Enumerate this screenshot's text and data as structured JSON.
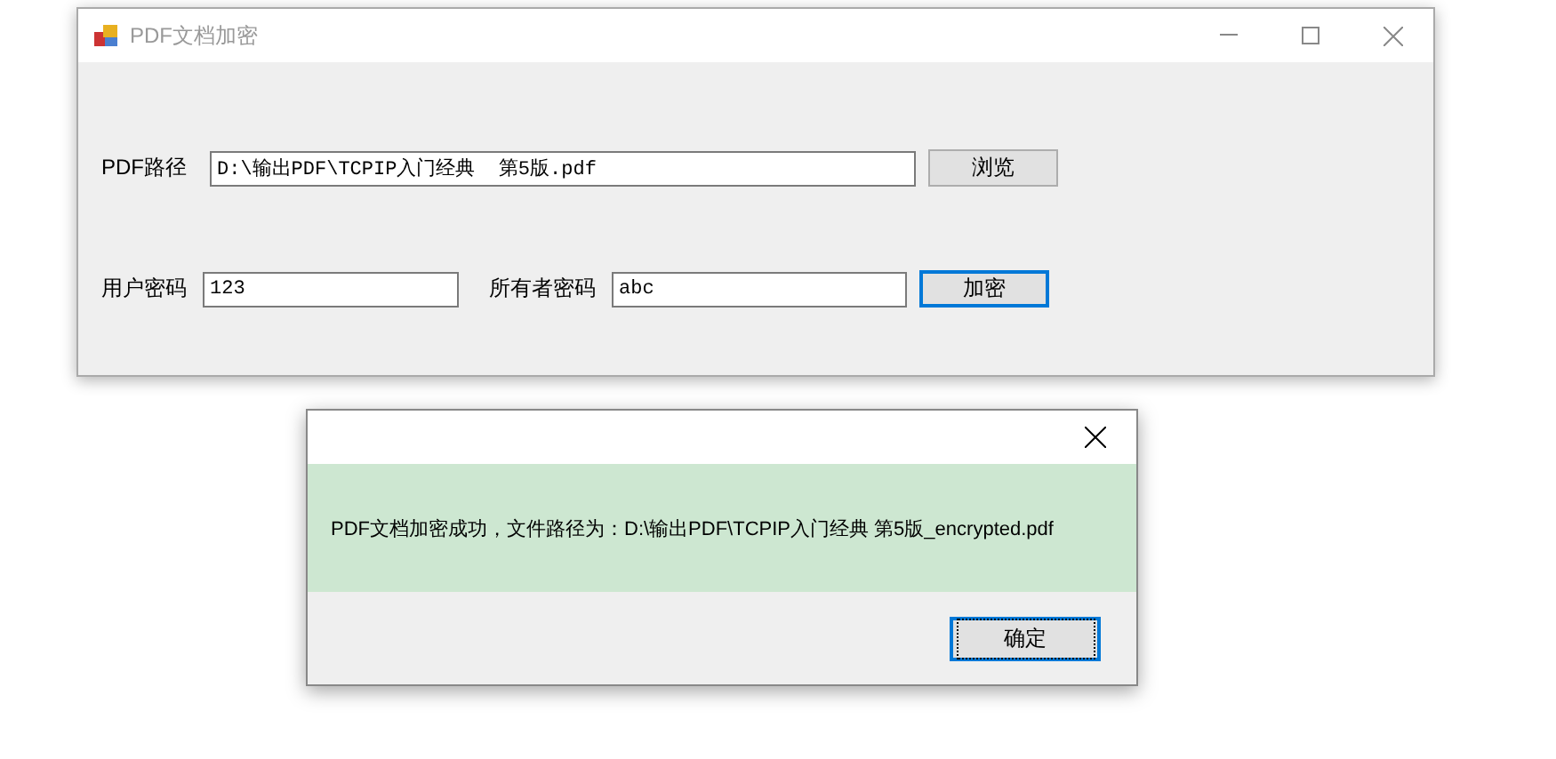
{
  "main_window": {
    "title": "PDF文档加密",
    "active": false,
    "rows": [
      {
        "fields": [
          {
            "label": "PDF路径",
            "value": "D:\\输出PDF\\TCPIP入门经典  第5版.pdf"
          }
        ],
        "button": {
          "label": "浏览",
          "focused": false
        }
      },
      {
        "fields": [
          {
            "label": "用户密码",
            "value": "123"
          },
          {
            "label": "所有者密码",
            "value": "abc"
          }
        ],
        "button": {
          "label": "加密",
          "focused": true
        }
      }
    ]
  },
  "dialog": {
    "message": "PDF文档加密成功，文件路径为：D:\\输出PDF\\TCPIP入门经典  第5版_encrypted.pdf",
    "button": {
      "label": "确定",
      "focused": true
    }
  }
}
